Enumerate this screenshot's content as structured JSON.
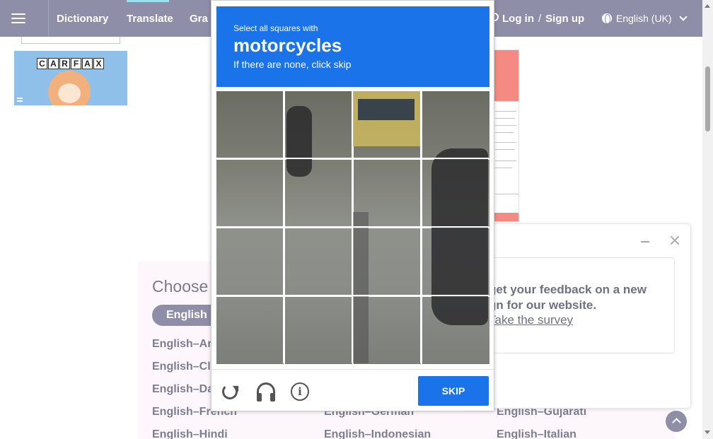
{
  "header": {
    "nav": [
      "Dictionary",
      "Translate",
      "Gra"
    ],
    "login": "Log in",
    "slash": "/",
    "signup": "Sign up",
    "language": "English (UK)"
  },
  "ad": {
    "brand_letters": [
      "C",
      "A",
      "R",
      "F",
      "A",
      "X"
    ]
  },
  "captcha": {
    "instruction": "Select all squares with",
    "object": "motorcycles",
    "hint": "If there are none, click skip",
    "skip_label": "SKIP"
  },
  "choose": {
    "title": "Choose",
    "pill": "English",
    "links": [
      "English–Ar",
      "English–Cl",
      "English–Da",
      "English–French",
      "English–German",
      "English–Gujarati",
      "English–Hindi",
      "English–Indonesian",
      "English–Italian"
    ]
  },
  "feedback": {
    "line1": "get your feedback on a new",
    "line2": "gn for our website.",
    "link": "Take the survey"
  },
  "colors": {
    "header": "#8e8ea8",
    "captcha_blue": "#1a73e8"
  }
}
